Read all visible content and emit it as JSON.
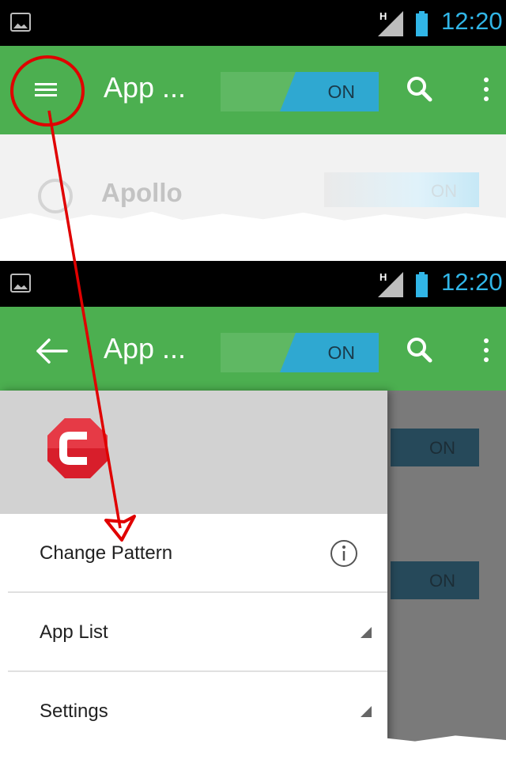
{
  "top_screen": {
    "status_bar": {
      "time": "12:20",
      "network": "H"
    },
    "app_bar": {
      "title": "App ...",
      "toggle_label": "ON"
    },
    "list_row": {
      "app_name": "Apollo",
      "toggle_label": "ON"
    }
  },
  "bottom_screen": {
    "status_bar": {
      "time": "12:20",
      "network": "H"
    },
    "app_bar": {
      "title": "App ...",
      "toggle_label": "ON"
    },
    "drawer": {
      "items": [
        {
          "label": "Change Pattern",
          "trailing_icon": "info-icon"
        },
        {
          "label": "App List",
          "trailing_icon": "expand-triangle-icon"
        },
        {
          "label": "Settings",
          "trailing_icon": "expand-triangle-icon"
        }
      ]
    },
    "background_toggles": [
      "ON",
      "ON"
    ]
  },
  "colors": {
    "app_bar": "#4caf50",
    "toggle_on": "#2fa8d1",
    "status_time": "#31b6e7",
    "annotation": "#e00000",
    "brand_logo": "#d81e2b"
  }
}
